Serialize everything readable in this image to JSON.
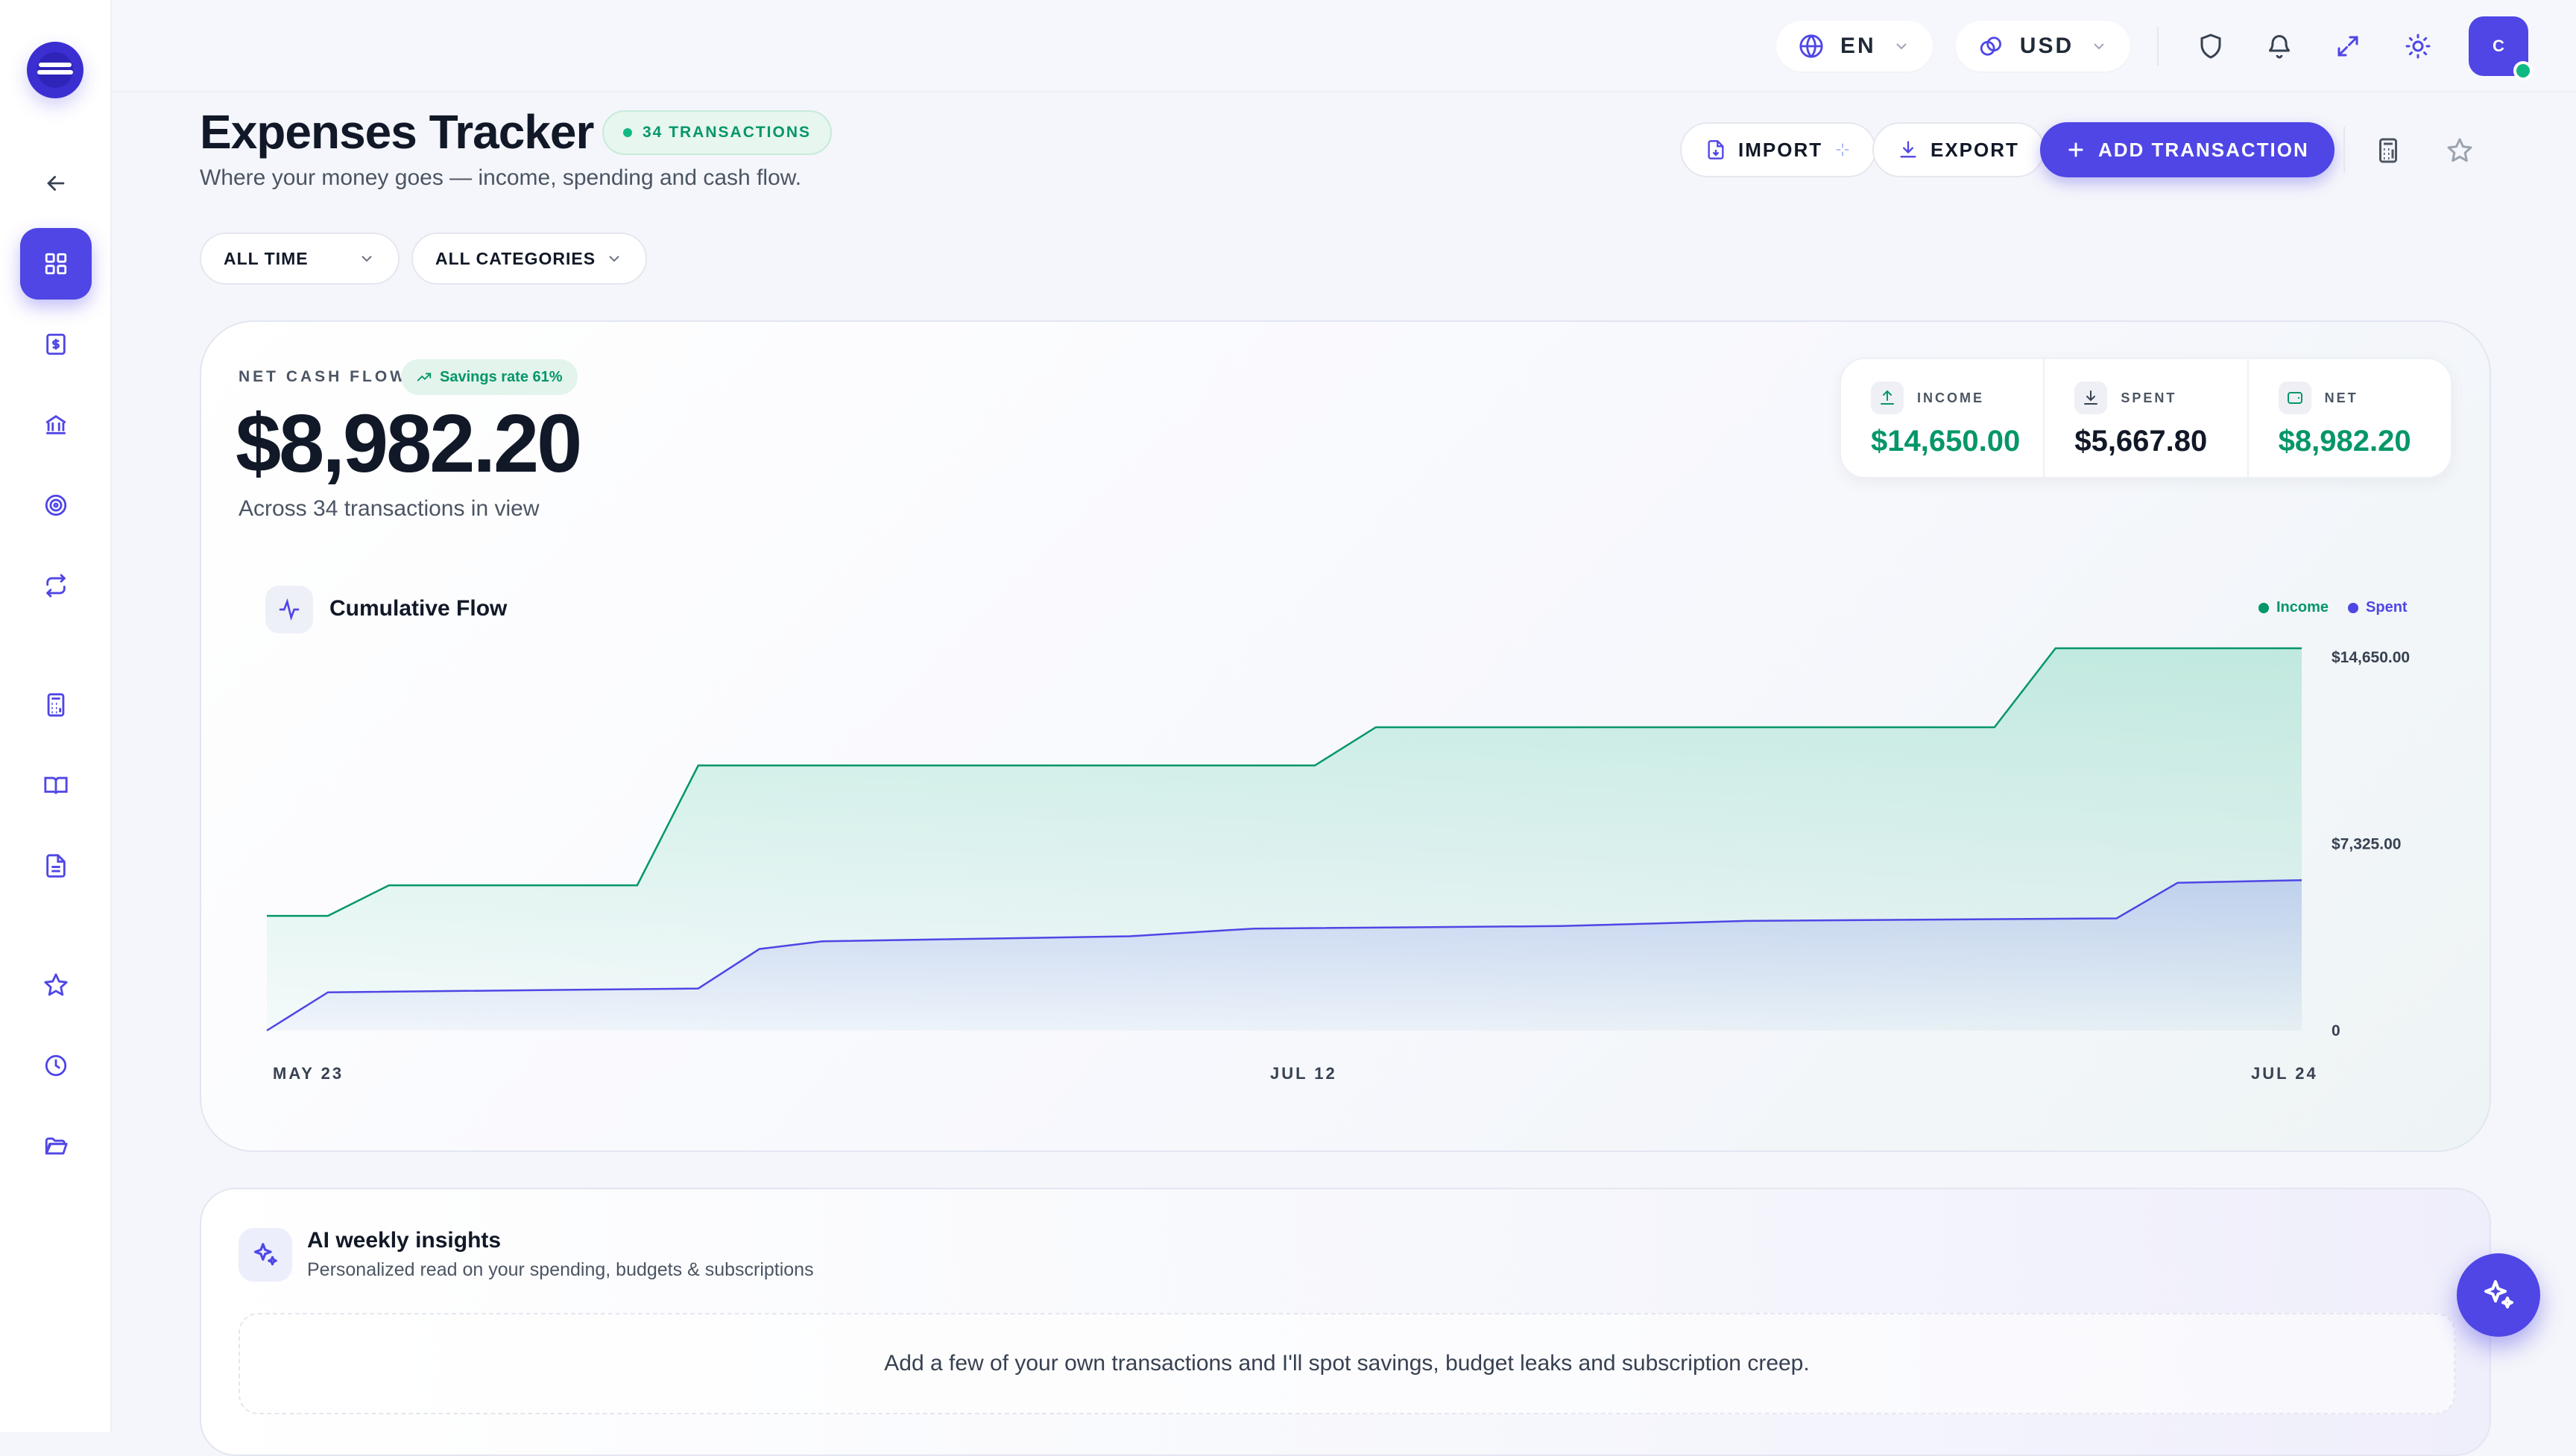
{
  "topbar": {
    "language": "EN",
    "currency": "USD",
    "avatar_initial": "C"
  },
  "header": {
    "title": "Expenses Tracker",
    "badge": "34 TRANSACTIONS",
    "subtitle": "Where your money goes — income, spending and cash flow.",
    "import_label": "IMPORT",
    "export_label": "EXPORT",
    "add_label": "ADD TRANSACTION"
  },
  "filters": {
    "time": "ALL TIME",
    "category": "ALL CATEGORIES"
  },
  "summary": {
    "label": "NET CASH FLOW",
    "savings": "Savings rate 61%",
    "value": "$8,982.20",
    "note": "Across 34 transactions in view",
    "stats": [
      {
        "label": "INCOME",
        "value": "$14,650.00",
        "color": "#059669",
        "icon": "income-icon"
      },
      {
        "label": "SPENT",
        "value": "$5,667.80",
        "color": "#111827",
        "icon": "spent-icon"
      },
      {
        "label": "NET",
        "value": "$8,982.20",
        "color": "#059669",
        "icon": "wallet-icon"
      }
    ]
  },
  "chart": {
    "title": "Cumulative Flow",
    "legend": {
      "income": "Income",
      "spent": "Spent"
    }
  },
  "chart_data": {
    "type": "area",
    "title": "Cumulative Flow",
    "x_ticks": [
      "MAY 23",
      "JUL 12",
      "JUL 24"
    ],
    "y_ticks": [
      "$14,650.00",
      "$7,325.00",
      "0"
    ],
    "ylim": [
      0,
      14650
    ],
    "grid": false,
    "legend_position": "top-right",
    "series": [
      {
        "name": "Income",
        "color": "#059669",
        "x": [
          0,
          0.03,
          0.06,
          0.182,
          0.212,
          0.515,
          0.545,
          0.849,
          0.879,
          1.0
        ],
        "values": [
          4500,
          4500,
          5700,
          5700,
          10400,
          10400,
          11900,
          11900,
          15000,
          15000
        ]
      },
      {
        "name": "Spent",
        "color": "#4f46e5",
        "x": [
          0,
          0.03,
          0.212,
          0.242,
          0.273,
          0.424,
          0.485,
          0.636,
          0.727,
          0.909,
          0.939,
          1.0
        ],
        "values": [
          0,
          1500,
          1650,
          3200,
          3500,
          3700,
          4000,
          4100,
          4300,
          4400,
          5800,
          5900
        ]
      }
    ]
  },
  "insights": {
    "title": "AI weekly insights",
    "subtitle": "Personalized read on your spending, budgets & subscriptions",
    "message": "Add a few of your own transactions and I'll spot savings, budget leaks and subscription creep."
  },
  "colors": {
    "accent": "#4f46e5",
    "income": "#059669",
    "background": "#f5f6fb"
  }
}
